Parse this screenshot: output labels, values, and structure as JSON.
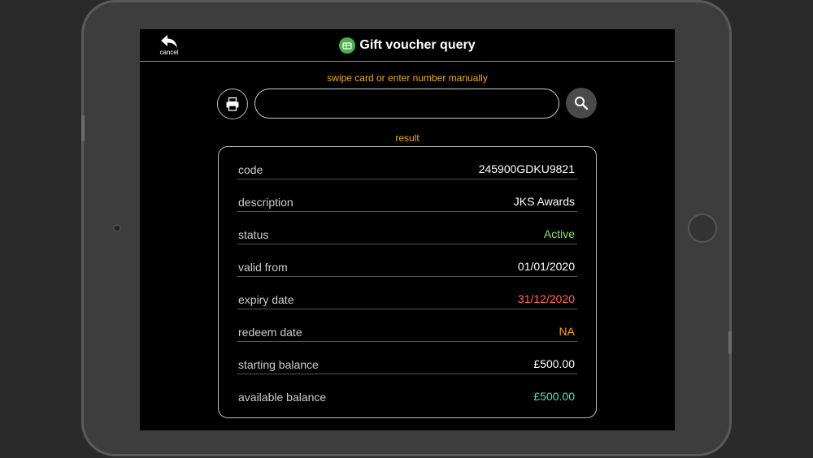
{
  "header": {
    "cancel_label": "cancel",
    "title": "Gift voucher query"
  },
  "search": {
    "hint": "swipe card or enter number manually",
    "value": "",
    "placeholder": ""
  },
  "result": {
    "label": "result",
    "rows": [
      {
        "key": "code",
        "value": "245900GDKU9821",
        "color": "#ffffff"
      },
      {
        "key": "description",
        "value": "JKS Awards",
        "color": "#ffffff"
      },
      {
        "key": "status",
        "value": "Active",
        "color": "#8ee27a"
      },
      {
        "key": "valid from",
        "value": "01/01/2020",
        "color": "#ffffff"
      },
      {
        "key": "expiry date",
        "value": "31/12/2020",
        "color": "#ff6b5a"
      },
      {
        "key": "redeem date",
        "value": "NA",
        "color": "#f5a623"
      },
      {
        "key": "starting balance",
        "value": "£500.00",
        "color": "#ffffff"
      },
      {
        "key": "available balance",
        "value": "£500.00",
        "color": "#4fe0c6"
      }
    ]
  },
  "icons": {
    "cancel": "undo-arrow-icon",
    "title": "gift-card-icon",
    "print": "printer-icon",
    "search": "magnifier-icon"
  },
  "colors": {
    "accent": "#f5a623",
    "title_icon_bg": "#4caf50",
    "search_button_bg": "#4a4a4a"
  }
}
